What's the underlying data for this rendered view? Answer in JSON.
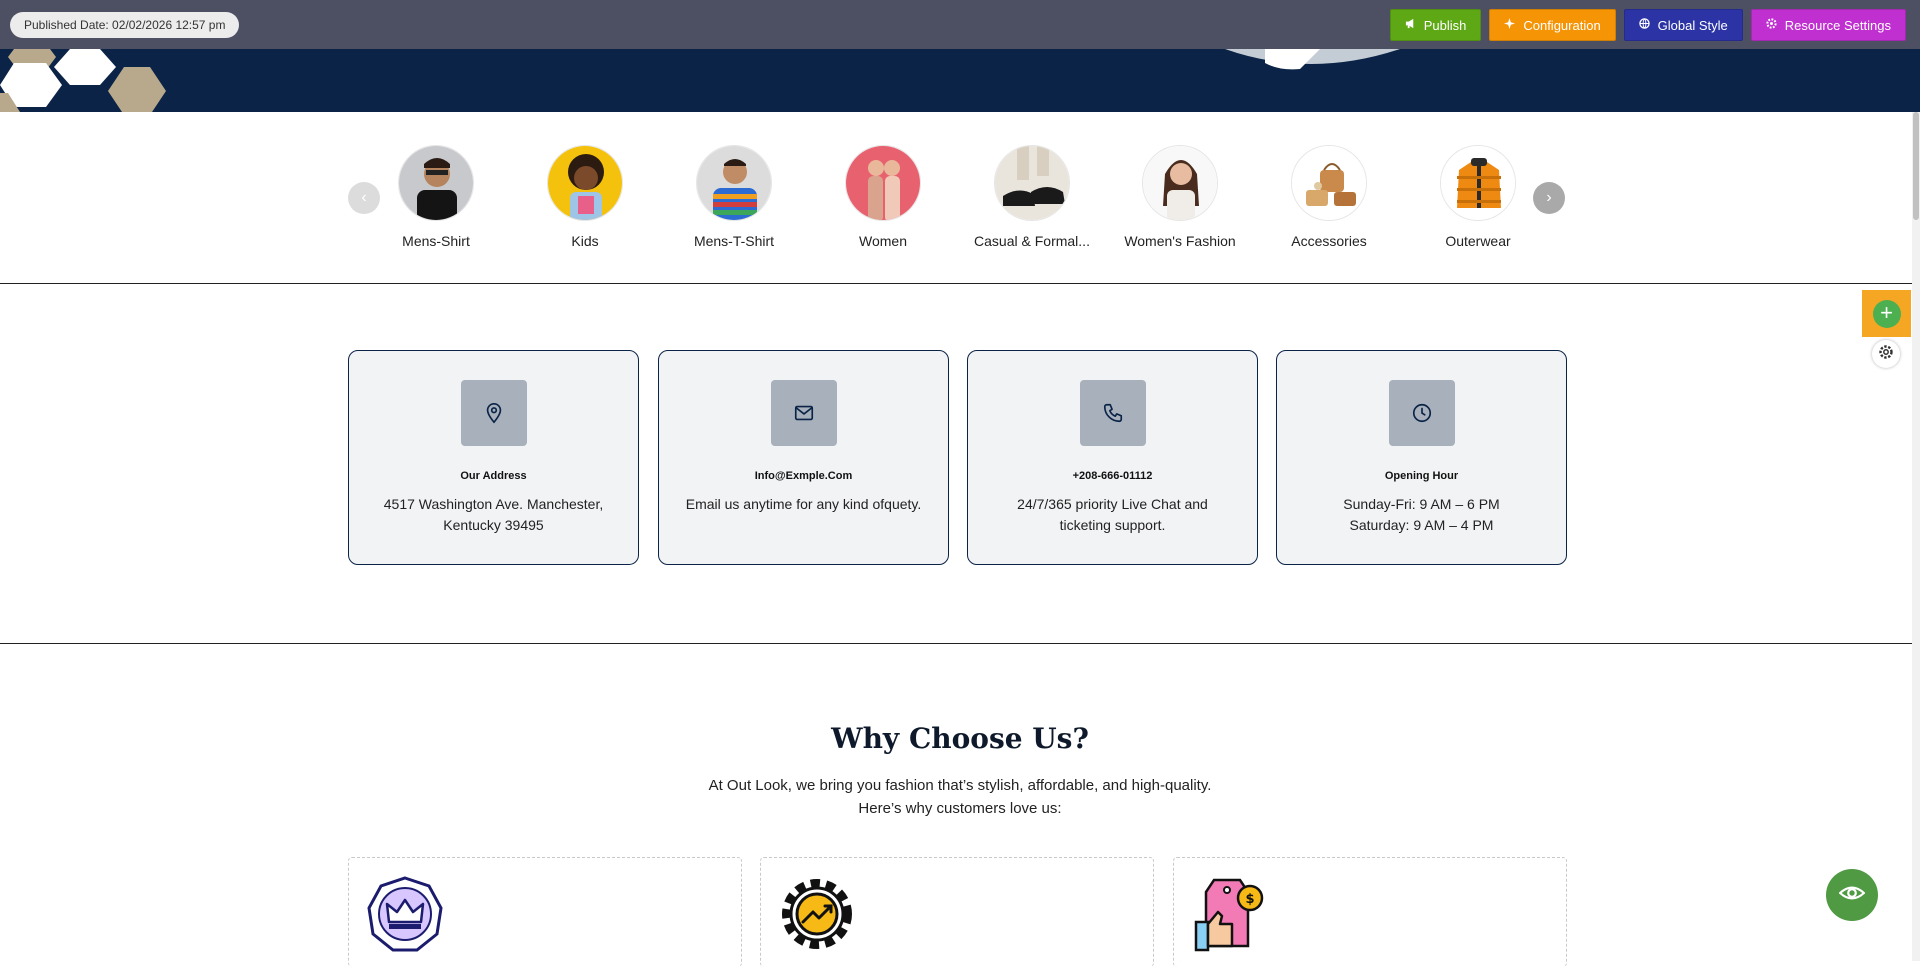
{
  "topbar": {
    "published_date": "Published Date: 02/02/2026 12:57 pm",
    "buttons": {
      "publish": "Publish",
      "configuration": "Configuration",
      "global_style": "Global Style",
      "resource_settings": "Resource Settings"
    }
  },
  "categories": {
    "prev_icon": "chevron-left-icon",
    "next_icon": "chevron-right-icon",
    "items": [
      {
        "label": "Mens-Shirt"
      },
      {
        "label": "Kids"
      },
      {
        "label": "Mens-T-Shirt"
      },
      {
        "label": "Women"
      },
      {
        "label": "Casual & Formal..."
      },
      {
        "label": "Women's Fashion"
      },
      {
        "label": "Accessories"
      },
      {
        "label": "Outerwear"
      }
    ]
  },
  "info_cards": [
    {
      "icon": "location-pin-icon",
      "title": "Our Address",
      "text": "4517 Washington Ave. Manchester, Kentucky 39495"
    },
    {
      "icon": "mail-icon",
      "title": "Info@Exmple.Com",
      "text": "Email us anytime for any kind ofquety."
    },
    {
      "icon": "phone-icon",
      "title": "+208-666-01112",
      "text": "24/7/365 priority Live Chat and ticketing support."
    },
    {
      "icon": "clock-icon",
      "title": "Opening Hour",
      "text_line1": "Sunday-Fri: 9 AM – 6 PM",
      "text_line2": "Saturday: 9 AM – 4 PM"
    }
  ],
  "why": {
    "title": "Why Choose Us?",
    "subtitle_line1": "At Out Look, we bring you fashion that’s stylish, affordable, and high-quality.",
    "subtitle_line2": "Here’s why customers love us:",
    "cards": [
      {
        "icon": "crown-icon"
      },
      {
        "icon": "gear-growth-icon"
      },
      {
        "icon": "thumbs-up-price-tag-icon"
      }
    ]
  },
  "colors": {
    "navy": "#0a2347",
    "topbar": "#4d4f62",
    "publish": "#5ea815",
    "configuration": "#f59405",
    "global_style": "#2b33a5",
    "resource_settings": "#c02fd0",
    "add_block": "#f5a623",
    "preview": "#4f9a43"
  }
}
